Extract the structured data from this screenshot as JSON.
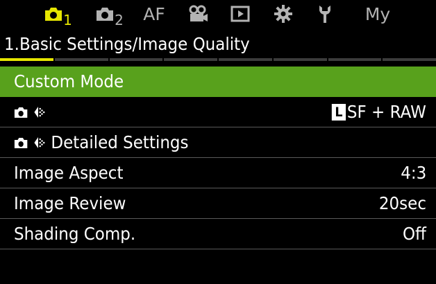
{
  "tabs": [
    {
      "id": "shoot1",
      "icon": "camera-icon",
      "sub": "1",
      "active": true
    },
    {
      "id": "shoot2",
      "icon": "camera-icon",
      "sub": "2",
      "active": false
    },
    {
      "id": "af",
      "text": "AF",
      "active": false
    },
    {
      "id": "video",
      "icon": "movie-camera-icon",
      "active": false
    },
    {
      "id": "playback",
      "icon": "playback-icon",
      "active": false
    },
    {
      "id": "setup",
      "icon": "gear-icon",
      "active": false
    },
    {
      "id": "custom",
      "icon": "wrench-icon",
      "active": false
    },
    {
      "id": "mymenu",
      "text": "My",
      "active": false
    }
  ],
  "page": {
    "title": "1.Basic Settings/Image Quality",
    "pager_total": 8,
    "pager_current": 1
  },
  "menu": {
    "items": [
      {
        "label": "Custom Mode",
        "value": "",
        "selected": true
      },
      {
        "label": "",
        "icon": "still-image-quality-icon",
        "value_prefix": "L",
        "value": "SF + RAW",
        "selected": false
      },
      {
        "label": "Detailed Settings",
        "icon": "still-image-quality-icon",
        "value": "",
        "selected": false
      },
      {
        "label": "Image Aspect",
        "value": "4:3",
        "selected": false
      },
      {
        "label": "Image Review",
        "value": "20sec",
        "selected": false
      },
      {
        "label": "Shading Comp.",
        "value": "Off",
        "selected": false
      }
    ]
  },
  "colors": {
    "active_tab": "#e6e600",
    "inactive_tab": "#b3b3b3",
    "selection": "#58a11c",
    "divider": "#5a5a5a"
  }
}
